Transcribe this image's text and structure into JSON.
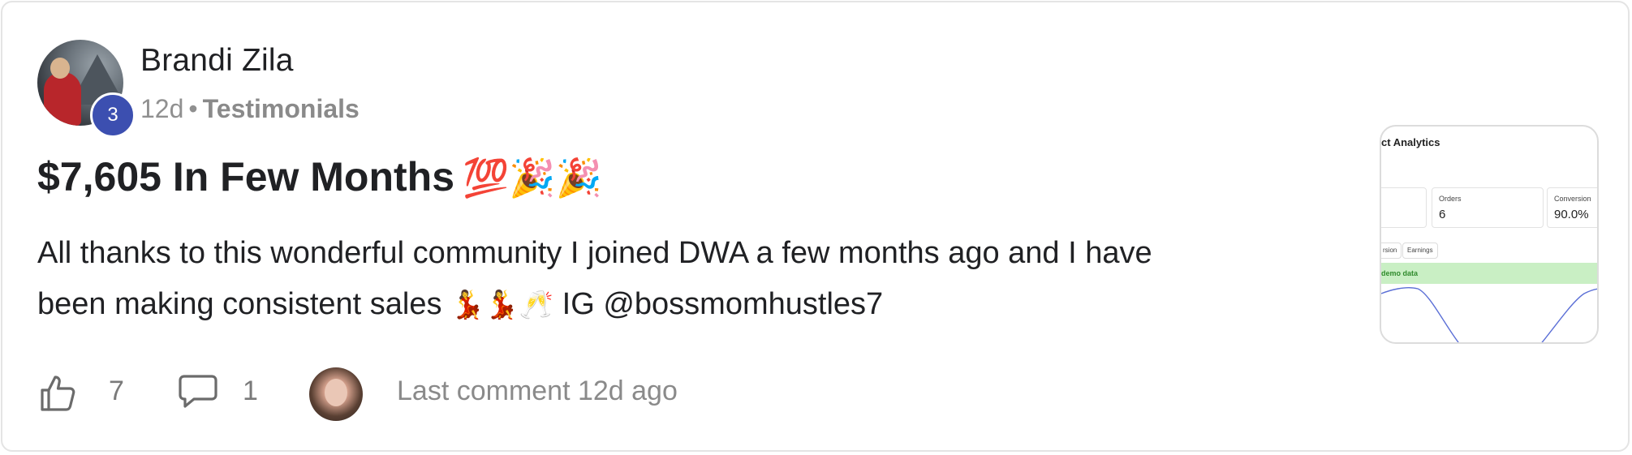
{
  "post": {
    "author": "Brandi Zila",
    "level": "3",
    "time": "12d",
    "separator": "•",
    "category": "Testimonials",
    "title": "$7,605 In Few Months",
    "title_emojis": "💯🎉🎉",
    "body_line1": "All thanks to this wonderful community I joined DWA a few months ago and I have",
    "body_line2_start": "been making consistent sales",
    "body_emojis": "💃💃🥂",
    "body_line2_end": "IG @bossmomhustles7"
  },
  "footer": {
    "like_icon": "thumbs-up-icon",
    "like_count": "7",
    "comment_icon": "comment-bubble-icon",
    "comment_count": "1",
    "last_comment": "Last comment 12d ago"
  },
  "thumbnail": {
    "title": "ct Analytics",
    "stats": [
      {
        "label": "Orders",
        "value": "6"
      },
      {
        "label": "Conversion",
        "value": "90.0%"
      }
    ],
    "chips": [
      "rsion",
      "Earnings"
    ],
    "banner": "demo data"
  },
  "colors": {
    "level_badge": "#3c4fb0",
    "muted_text": "#8a8a8a",
    "border": "#e4e4e4",
    "chart_line": "#5b6fd6",
    "banner_bg": "#c9efc4"
  }
}
